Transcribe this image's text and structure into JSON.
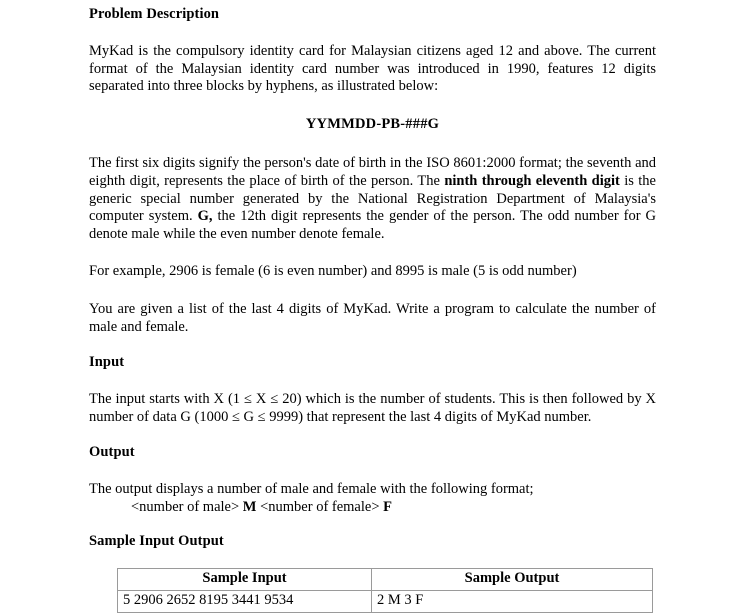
{
  "document": {
    "sections": {
      "problem_description_heading": "Problem Description",
      "input_heading": "Input",
      "output_heading": "Output",
      "sample_heading": "Sample Input Output"
    },
    "paragraphs": {
      "intro": "MyKad is the compulsory identity card for Malaysian citizens aged 12 and above. The current format of the Malaysian identity card number was introduced in 1990, features 12 digits separated into three blocks by hyphens, as illustrated below:",
      "format_code": "YYMMDD-PB-###G",
      "digits_explain_1": "The first six digits signify the person's date of birth in the ISO 8601:2000 format; the seventh and eighth digit, represents the place of birth of the person. The ",
      "digits_explain_bold_1": "ninth through eleventh digit",
      "digits_explain_2": " is the generic special number generated by the National Registration Department of Malaysia's computer system. ",
      "digits_explain_bold_2": "G,",
      "digits_explain_3": " the 12th digit represents the gender of the person. The odd number for G denote male while the even number denote female.",
      "example": "For example, 2906 is female (6 is even number) and 8995 is male (5 is odd number)",
      "task": "You are given a list of the last 4 digits of MyKad. Write a program to calculate the number of male and female.",
      "input_desc": "The input starts with X (1 ≤ X ≤ 20) which is the number of students. This is then followed by X number of data G (1000 ≤ G ≤ 9999) that represent the last 4 digits of MyKad number.",
      "output_desc": "The output displays a number of male and female with the following format;",
      "output_format_part1": "<number of male> ",
      "output_format_bold1": "M",
      "output_format_part2": " <number of female> ",
      "output_format_bold2": "F"
    },
    "sample_table": {
      "headers": [
        "Sample Input",
        "Sample Output"
      ],
      "rows": [
        [
          "5 2906 2652 8195 3441 9534",
          "2 M 3 F"
        ]
      ]
    }
  }
}
